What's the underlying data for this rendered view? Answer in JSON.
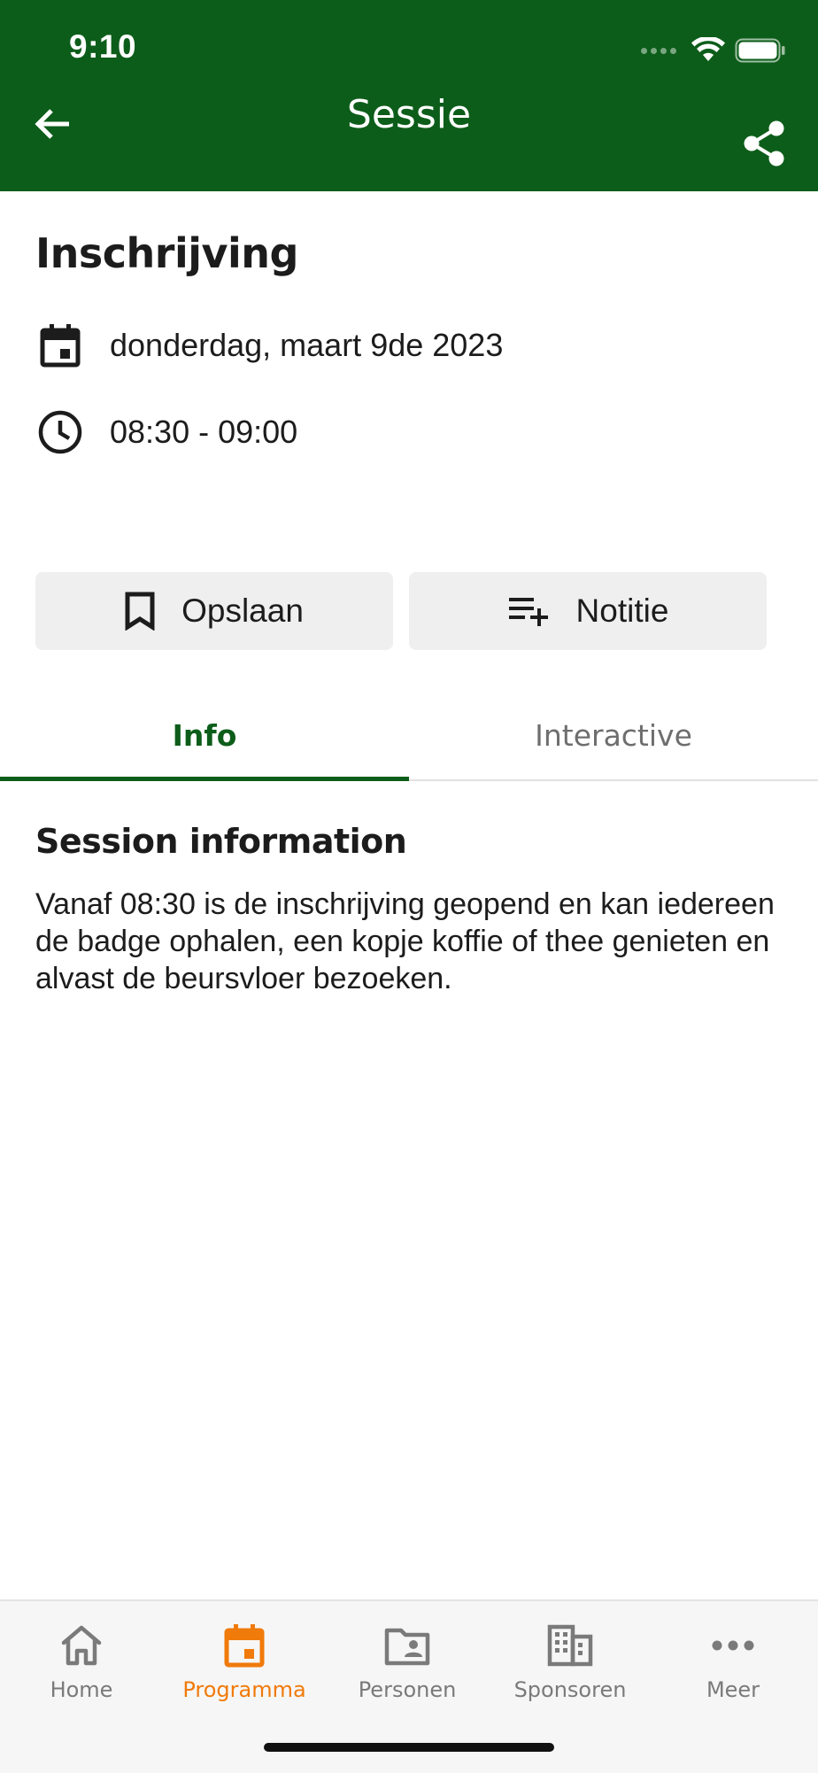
{
  "status_bar": {
    "time": "9:10"
  },
  "header": {
    "title": "Sessie"
  },
  "session": {
    "title": "Inschrijving",
    "date": "donderdag, maart 9de 2023",
    "time_range": "08:30 - 09:00"
  },
  "actions": {
    "save_label": "Opslaan",
    "note_label": "Notitie"
  },
  "tabs": [
    {
      "label": "Info",
      "active": true
    },
    {
      "label": "Interactive",
      "active": false
    }
  ],
  "info": {
    "heading": "Session information",
    "body": "Vanaf 08:30 is de inschrijving geopend en kan iedereen de badge ophalen, een kopje koffie of thee genieten en alvast de beursvloer bezoeken."
  },
  "bottom_nav": {
    "items": [
      {
        "label": "Home",
        "icon": "home-icon",
        "active": false
      },
      {
        "label": "Programma",
        "icon": "calendar-icon",
        "active": true
      },
      {
        "label": "Personen",
        "icon": "contacts-folder-icon",
        "active": false
      },
      {
        "label": "Sponsoren",
        "icon": "building-icon",
        "active": false
      },
      {
        "label": "Meer",
        "icon": "more-dots-icon",
        "active": false
      }
    ]
  },
  "colors": {
    "brand_green": "#0d5d1a",
    "active_orange": "#f07a0a",
    "button_bg": "#efefef",
    "inactive_gray": "#7a7a7a"
  }
}
